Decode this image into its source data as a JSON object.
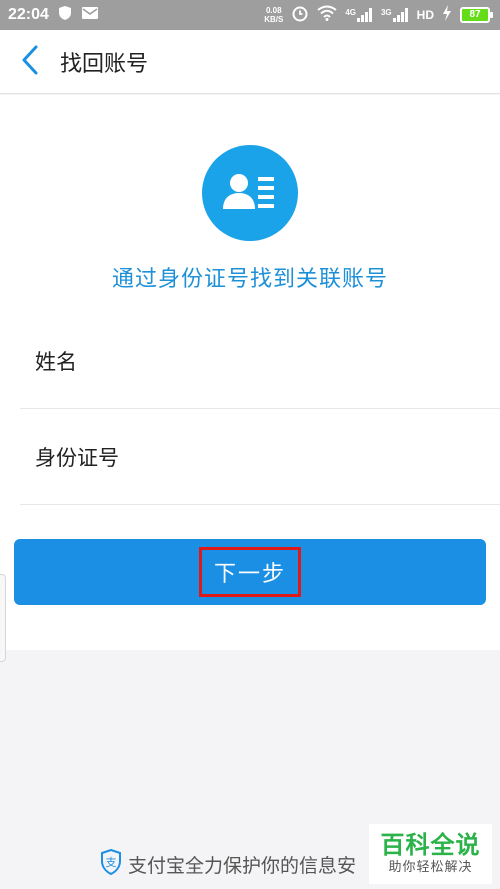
{
  "status_bar": {
    "time": "22:04",
    "net_speed_value": "0.08",
    "net_speed_unit": "KB/S",
    "signal_1": "4G",
    "signal_2": "3G",
    "hd": "HD",
    "battery": "87"
  },
  "nav": {
    "back_icon": "chevron-left-icon",
    "title": "找回账号"
  },
  "hero": {
    "icon": "id-card-user-icon",
    "subtitle": "通过身份证号找到关联账号",
    "accent_color": "#1aa3e8"
  },
  "form": {
    "name_label": "姓名",
    "name_value": "",
    "id_label": "身份证号",
    "id_value": "",
    "submit_label": "下一步",
    "button_color": "#1b8fe4",
    "highlight_color": "#e01818"
  },
  "footer": {
    "shield_icon": "alipay-shield-icon",
    "text": "支付宝全力保护你的信息安"
  },
  "watermark": {
    "main": "百科全说",
    "sub": "助你轻松解决"
  }
}
